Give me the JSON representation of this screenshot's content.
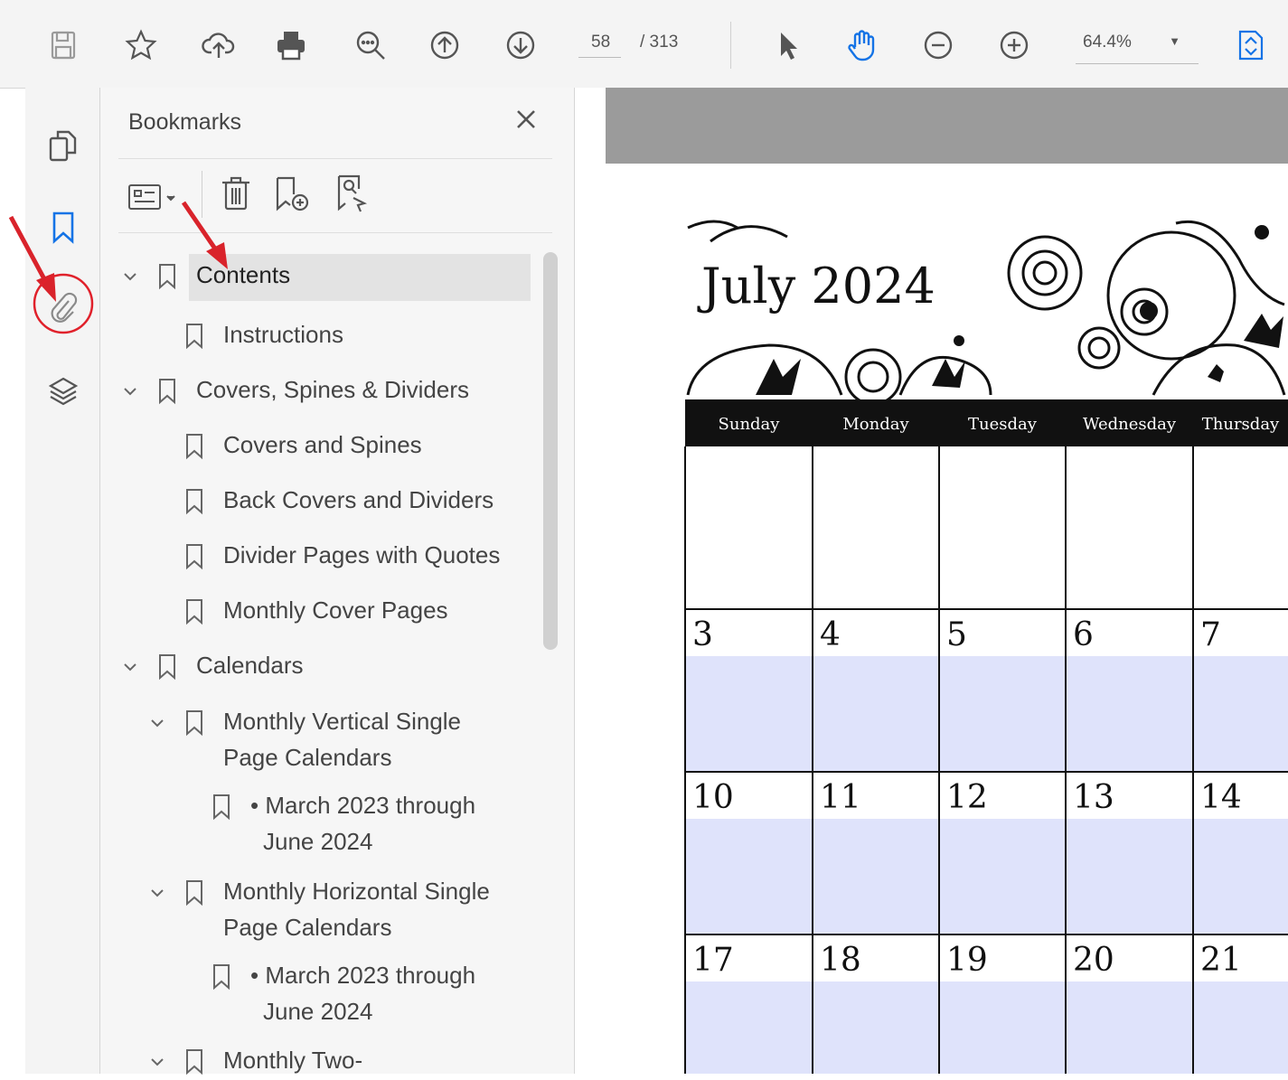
{
  "toolbar": {
    "current_page": "58",
    "total_pages": "/ 313",
    "zoom": "64.4%",
    "icons": [
      "save-icon",
      "star-icon",
      "cloud-upload-icon",
      "print-icon",
      "zoom-search-icon",
      "page-up-icon",
      "page-down-icon",
      "select-cursor-icon",
      "hand-tool-icon",
      "zoom-out-icon",
      "zoom-in-icon",
      "page-fit-icon"
    ]
  },
  "rail": {
    "icons": [
      "pages-icon",
      "bookmark-icon",
      "attachment-icon",
      "layers-icon"
    ]
  },
  "bookmarks": {
    "title": "Bookmarks",
    "items": [
      {
        "label": "Contents",
        "selected": true
      },
      {
        "label": "Instructions"
      },
      {
        "label": "Covers, Spines & Dividers"
      },
      {
        "label": "Covers and Spines"
      },
      {
        "label": "Back Covers and Dividers"
      },
      {
        "label": "Divider Pages with Quotes"
      },
      {
        "label": "Monthly Cover Pages"
      },
      {
        "label": "Calendars"
      },
      {
        "label": "Monthly Vertical Single",
        "label2": "Page Calendars"
      },
      {
        "label": "• March 2023 through",
        "label2": "June 2024"
      },
      {
        "label": "Monthly Horizontal Single",
        "label2": "Page Calendars"
      },
      {
        "label": "• March 2023 through",
        "label2": "June 2024"
      },
      {
        "label": "Monthly Two-"
      }
    ]
  },
  "calendar": {
    "title": "July 2024",
    "days": [
      "Sunday",
      "Monday",
      "Tuesday",
      "Wednesday",
      "Thursday"
    ],
    "rows": [
      [
        "",
        "",
        "",
        "",
        ""
      ],
      [
        "3",
        "4",
        "5",
        "6",
        "7"
      ],
      [
        "10",
        "11",
        "12",
        "13",
        "14"
      ],
      [
        "17",
        "18",
        "19",
        "20",
        "21"
      ]
    ]
  },
  "colors": {
    "highlight_circle": "#e0212b",
    "arrow": "#d9232b",
    "cell_fill": "#dfe3fb",
    "accent_blue": "#1473e6"
  }
}
